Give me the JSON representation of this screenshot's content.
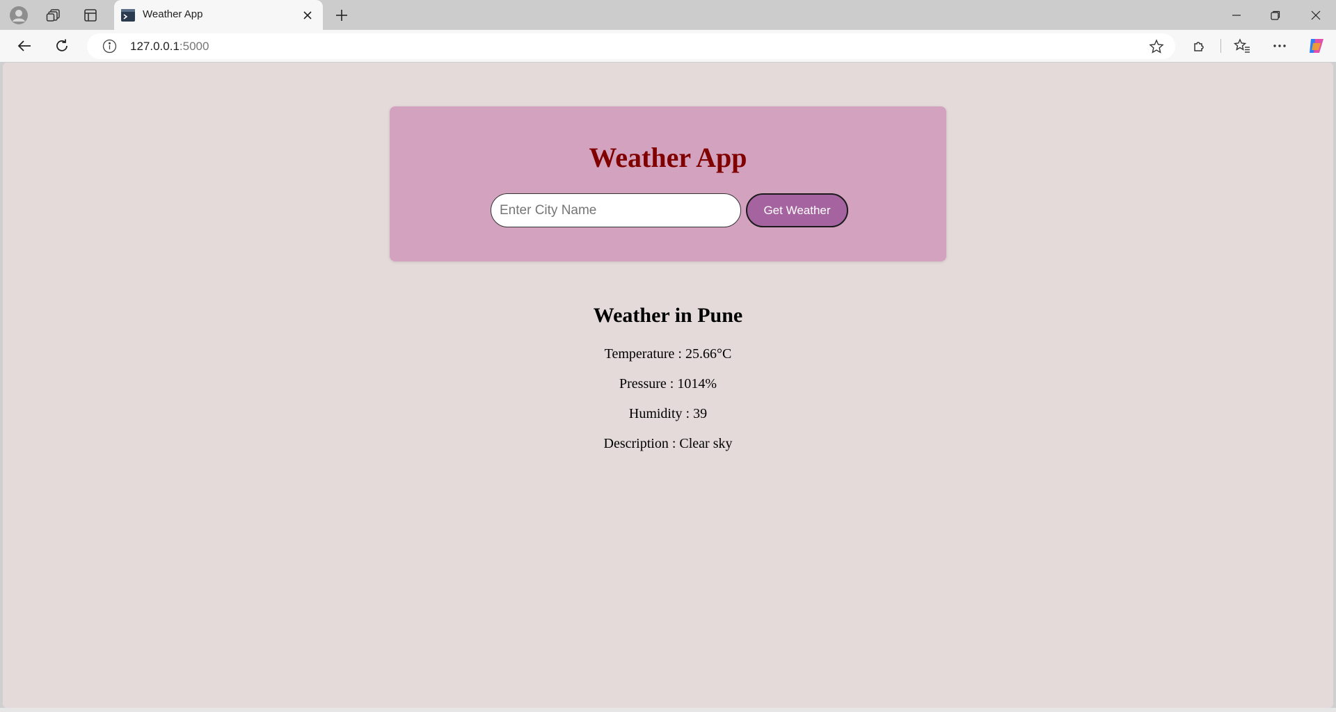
{
  "browser": {
    "tab_title": "Weather App",
    "url_host": "127.0.0.1",
    "url_port": ":5000"
  },
  "page": {
    "title": "Weather App",
    "input_placeholder": "Enter City Name",
    "input_value": "",
    "button_label": "Get Weather",
    "result": {
      "heading": "Weather in Pune",
      "temperature": "Temperature : 25.66°C",
      "pressure": "Pressure : 1014%",
      "humidity": "Humidity : 39",
      "description": "Description : Clear sky"
    }
  },
  "colors": {
    "page_bg": "#e4dada",
    "card_bg": "#d3a2bf",
    "title_color": "#800000",
    "button_bg": "#a564a0"
  },
  "icons": [
    "profile-icon",
    "collections-icon",
    "tab-actions-icon",
    "terminal-favicon-icon",
    "close-icon",
    "plus-icon",
    "minimize-icon",
    "restore-icon",
    "window-close-icon",
    "back-icon",
    "refresh-icon",
    "info-icon",
    "star-icon",
    "extensions-icon",
    "favorites-icon",
    "more-icon",
    "copilot-icon"
  ]
}
